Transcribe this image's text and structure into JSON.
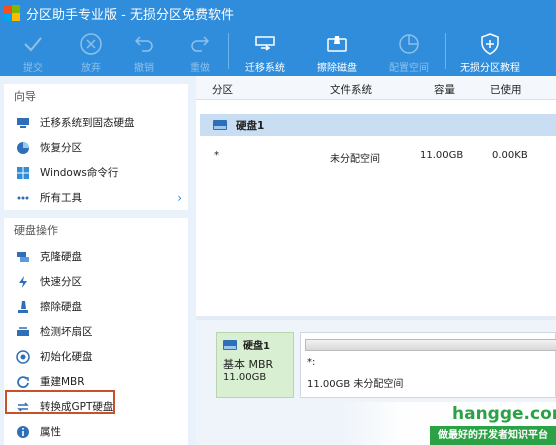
{
  "window": {
    "title": "分区助手专业版 - 无损分区免费软件"
  },
  "toolbar": {
    "buttons": [
      {
        "label": "提交",
        "icon": "check-icon",
        "enabled": false
      },
      {
        "label": "放弃",
        "icon": "cancel-circle-icon",
        "enabled": false
      },
      {
        "label": "撤销",
        "icon": "undo-icon",
        "enabled": false
      },
      {
        "label": "重做",
        "icon": "redo-icon",
        "enabled": false
      },
      {
        "label": "迁移系统",
        "icon": "migrate-system-icon",
        "enabled": true
      },
      {
        "label": "擦除磁盘",
        "icon": "wipe-disk-icon",
        "enabled": true
      },
      {
        "label": "配置空间",
        "icon": "allocate-space-icon",
        "enabled": false
      },
      {
        "label": "无损分区教程",
        "icon": "shield-icon",
        "enabled": true
      }
    ]
  },
  "sidebar": {
    "wizard": {
      "title": "向导",
      "items": [
        {
          "label": "迁移系统到固态硬盘",
          "icon": "migrate-ssd-icon"
        },
        {
          "label": "恢复分区",
          "icon": "recover-partition-icon"
        },
        {
          "label": "Windows命令行",
          "icon": "windows-icon"
        },
        {
          "label": "所有工具",
          "icon": "more-icon"
        }
      ]
    },
    "disk_ops": {
      "title": "硬盘操作",
      "items": [
        {
          "label": "克隆硬盘",
          "icon": "clone-disk-icon"
        },
        {
          "label": "快速分区",
          "icon": "lightning-icon"
        },
        {
          "label": "擦除硬盘",
          "icon": "eraser-icon"
        },
        {
          "label": "检测坏扇区",
          "icon": "scan-sector-icon"
        },
        {
          "label": "初始化硬盘",
          "icon": "init-disk-icon"
        },
        {
          "label": "重建MBR",
          "icon": "rebuild-mbr-icon"
        },
        {
          "label": "转换成GPT硬盘",
          "icon": "convert-icon"
        },
        {
          "label": "属性",
          "icon": "info-icon"
        }
      ]
    }
  },
  "table": {
    "columns": [
      "分区",
      "文件系统",
      "容量",
      "已使用"
    ],
    "disk_label": "硬盘1",
    "rows": [
      {
        "partition": "*",
        "filesystem": "未分配空间",
        "capacity": "11.00GB",
        "used": "0.00KB"
      }
    ]
  },
  "disk_map": {
    "disk_name": "硬盘1",
    "disk_type": "基本 MBR",
    "disk_size": "11.00GB",
    "partition_label": "*:",
    "partition_desc": "11.00GB 未分配空间"
  },
  "watermark": {
    "site": "hangge.com",
    "slogan": "做最好的开发者知识平台"
  },
  "colors": {
    "titlebar": "#2f8ddb",
    "highlight_border": "#c8502a",
    "disk_card": "#d9efd2",
    "watermark_green": "#2ba245"
  }
}
